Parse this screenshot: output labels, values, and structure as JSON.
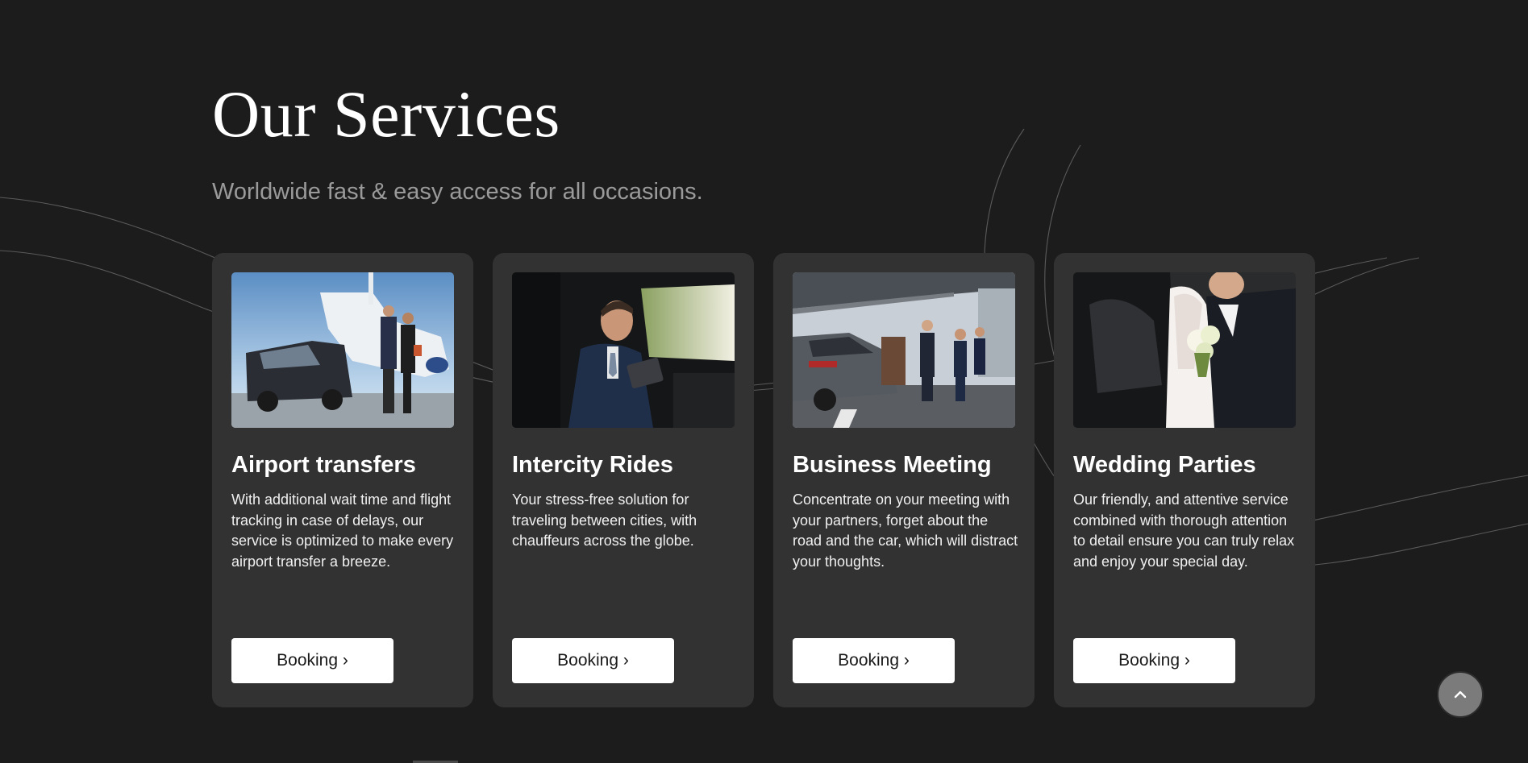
{
  "section": {
    "title": "Our Services",
    "subtitle": "Worldwide fast & easy access for all occasions."
  },
  "services": [
    {
      "title": "Airport transfers",
      "description": "With additional wait time and flight tracking in case of delays, our service is optimized to make every airport transfer a breeze.",
      "button_label": "Booking ›",
      "image_subject": "van-and-private-jet"
    },
    {
      "title": "Intercity Rides",
      "description": "Your stress-free solution for traveling between cities, with chauffeurs across the globe.",
      "button_label": "Booking ›",
      "image_subject": "passenger-in-car-with-tablet"
    },
    {
      "title": "Business Meeting",
      "description": "Concentrate on your meeting with your partners, forget about the road and the car, which will distract your thoughts.",
      "button_label": "Booking ›",
      "image_subject": "chauffeur-and-business-people"
    },
    {
      "title": "Wedding Parties",
      "description": "Our friendly, and attentive service combined with thorough attention to detail ensure you can truly relax and enjoy your special day.",
      "button_label": "Booking ›",
      "image_subject": "bride-and-groom-at-car"
    }
  ],
  "scroll_top": {
    "icon": "chevron-up-icon"
  },
  "colors": {
    "background": "#1c1c1c",
    "card": "#323232",
    "button": "#ffffff",
    "subtitle": "#9a9a9a",
    "scroll_button": "#7b7b7b"
  }
}
